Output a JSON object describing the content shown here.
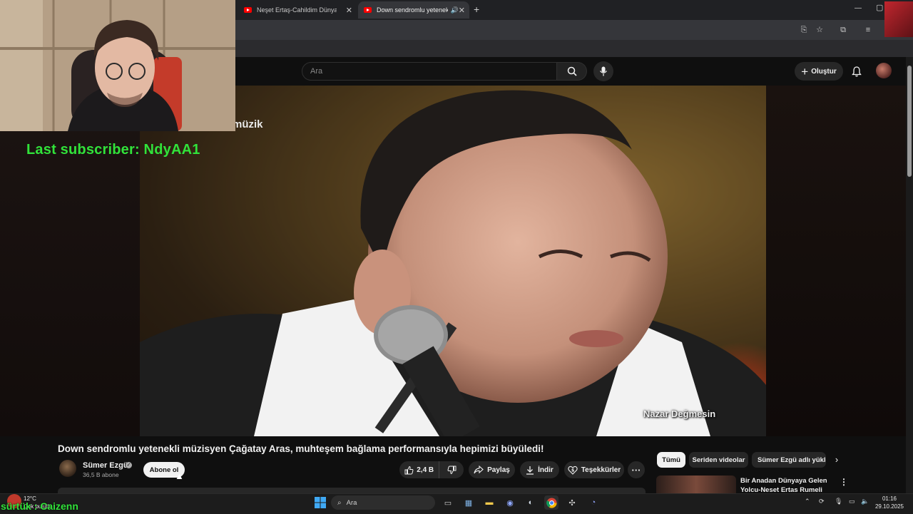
{
  "browser": {
    "tabs": [
      {
        "label": "Neşet Ertaş-Cahildim Dünyanın",
        "active": false
      },
      {
        "label": "Down sendromlu yetenekli",
        "active": true
      }
    ],
    "new_tab_label": "+"
  },
  "youtube": {
    "search_placeholder": "Ara",
    "create_label": "Oluştur",
    "video_caption": "Nazar Değmesin",
    "video_watermark": "müzik",
    "video_title": "Down sendromlu yetenekli müzisyen Çağatay Aras, muhteşem bağlama performansıyla hepimizi büyüledi!",
    "channel": {
      "name": "Sümer Ezgü",
      "subscribers": "36,5 B abone",
      "subscribe_label": "Abone ol"
    },
    "actions": {
      "likes": "2,4 B",
      "share": "Paylaş",
      "download": "İndir",
      "thanks": "Teşekkürler",
      "more": "···"
    },
    "chips": [
      "Tümü",
      "Seriden videolar",
      "Sümer Ezgü adlı yükle"
    ],
    "related": [
      {
        "title": "Bir Anadan Dünyaya Gelen Yolcu-Neşet Ertaş Rumeli Hisa"
      }
    ]
  },
  "overlay": {
    "last_subscriber": "Last subscriber: NdyAA1",
    "bottom_text": "sürtük : Caizenn"
  },
  "taskbar": {
    "search_placeholder": "Ara",
    "weather_temp": "12°C",
    "weather_desc": "Çok bulutlu",
    "time": "01:16",
    "date": "29.10.2025"
  },
  "colors": {
    "overlay_green": "#31e23a",
    "yt_red": "#ff0000"
  }
}
